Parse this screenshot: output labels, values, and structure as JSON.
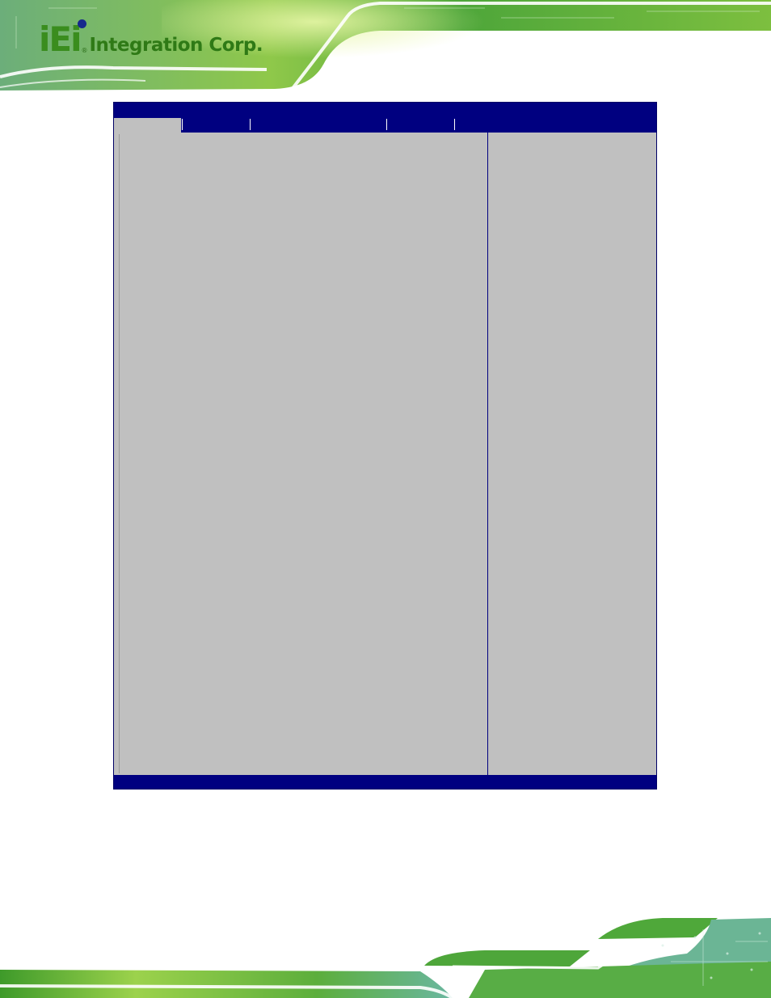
{
  "brand": {
    "logo_mark": "iEi",
    "logo_registered": "®",
    "logo_text": "Integration Corp.",
    "colors": {
      "brand_green": "#3a8d1e",
      "brand_blue": "#16288c"
    }
  },
  "bios": {
    "colors": {
      "frame": "#000080",
      "panel": "#c0c0c0"
    },
    "tabs": [
      {
        "label": "",
        "active": true
      },
      {
        "label": "",
        "active": false
      },
      {
        "label": "",
        "active": false
      },
      {
        "label": "",
        "active": false
      },
      {
        "label": "",
        "active": false
      }
    ]
  }
}
